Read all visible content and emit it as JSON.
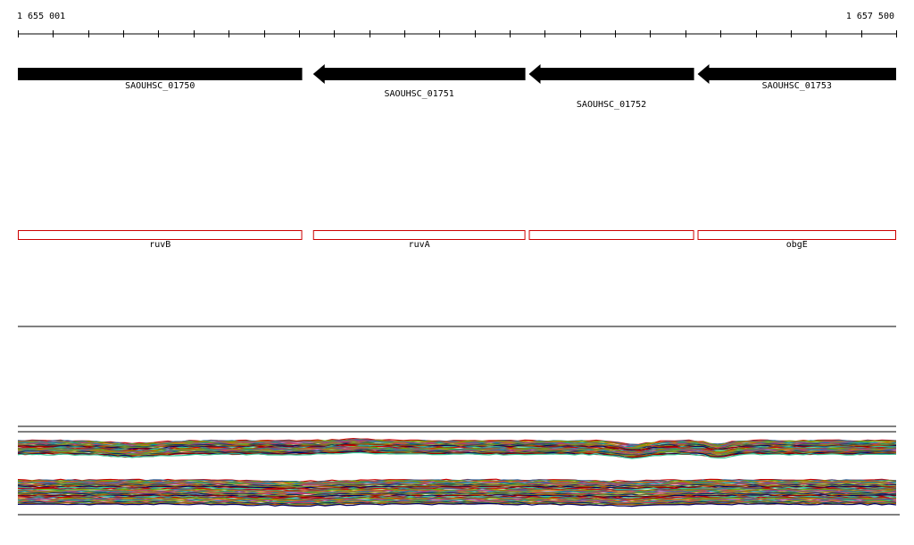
{
  "ruler": {
    "start_label": "1 655 001",
    "end_label": "1 657 500",
    "start": 1655001,
    "end": 1657500
  },
  "genes": [
    {
      "id": "SAOUHSC_01750",
      "strand": "+",
      "start": 1655001,
      "end": 1655810
    },
    {
      "id": "SAOUHSC_01751",
      "strand": "-",
      "start": 1655841,
      "end": 1656445
    },
    {
      "id": "SAOUHSC_01752",
      "strand": "-",
      "start": 1656455,
      "end": 1656925
    },
    {
      "id": "SAOUHSC_01753",
      "strand": "-",
      "start": 1656935,
      "end": 1657500
    }
  ],
  "annotations": [
    {
      "name": "ruvB",
      "start": 1655001,
      "end": 1655810
    },
    {
      "name": "ruvA",
      "start": 1655841,
      "end": 1656445
    },
    {
      "name": "",
      "start": 1656455,
      "end": 1656925
    },
    {
      "name": "obgE",
      "start": 1656935,
      "end": 1657500
    }
  ],
  "colors": {
    "gene_fill": "#000000",
    "annotation_stroke": "#cc0000",
    "trace_palette": [
      "#cc0000",
      "#336699",
      "#66aa00",
      "#cc6600",
      "#993399",
      "#009999",
      "#999900",
      "#cc3366",
      "#003366",
      "#669933",
      "#aa5500",
      "#000066",
      "#990000",
      "#33cc99"
    ]
  }
}
